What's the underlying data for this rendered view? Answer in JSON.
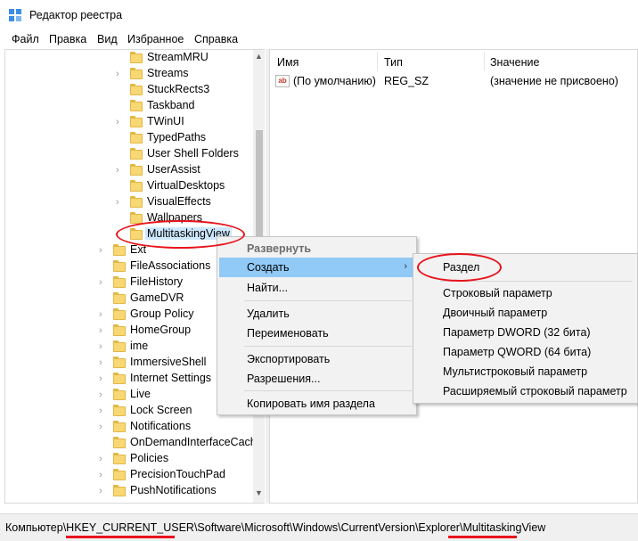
{
  "window": {
    "title": "Редактор реестра"
  },
  "menu": [
    "Файл",
    "Правка",
    "Вид",
    "Избранное",
    "Справка"
  ],
  "tree": {
    "items": [
      {
        "label": "StreamMRU",
        "level": 2,
        "expand": false
      },
      {
        "label": "Streams",
        "level": 2,
        "expand": true
      },
      {
        "label": "StuckRects3",
        "level": 2,
        "expand": false
      },
      {
        "label": "Taskband",
        "level": 2,
        "expand": false
      },
      {
        "label": "TWinUI",
        "level": 2,
        "expand": true
      },
      {
        "label": "TypedPaths",
        "level": 2,
        "expand": false
      },
      {
        "label": "User Shell Folders",
        "level": 2,
        "expand": false
      },
      {
        "label": "UserAssist",
        "level": 2,
        "expand": true
      },
      {
        "label": "VirtualDesktops",
        "level": 2,
        "expand": false
      },
      {
        "label": "VisualEffects",
        "level": 2,
        "expand": true
      },
      {
        "label": "Wallpapers",
        "level": 2,
        "expand": false
      },
      {
        "label": "MultitaskingView",
        "level": 2,
        "expand": false,
        "selected": true
      },
      {
        "label": "Ext",
        "level": 1,
        "expand": true
      },
      {
        "label": "FileAssociations",
        "level": 1,
        "expand": false
      },
      {
        "label": "FileHistory",
        "level": 1,
        "expand": true
      },
      {
        "label": "GameDVR",
        "level": 1,
        "expand": false
      },
      {
        "label": "Group Policy",
        "level": 1,
        "expand": true
      },
      {
        "label": "HomeGroup",
        "level": 1,
        "expand": true
      },
      {
        "label": "ime",
        "level": 1,
        "expand": true
      },
      {
        "label": "ImmersiveShell",
        "level": 1,
        "expand": true
      },
      {
        "label": "Internet Settings",
        "level": 1,
        "expand": true
      },
      {
        "label": "Live",
        "level": 1,
        "expand": true
      },
      {
        "label": "Lock Screen",
        "level": 1,
        "expand": true
      },
      {
        "label": "Notifications",
        "level": 1,
        "expand": true
      },
      {
        "label": "OnDemandInterfaceCach",
        "level": 1,
        "expand": false
      },
      {
        "label": "Policies",
        "level": 1,
        "expand": true
      },
      {
        "label": "PrecisionTouchPad",
        "level": 1,
        "expand": true
      },
      {
        "label": "PushNotifications",
        "level": 1,
        "expand": true
      }
    ]
  },
  "list": {
    "columns": [
      "Имя",
      "Тип",
      "Значение"
    ],
    "rows": [
      {
        "name": "(По умолчанию)",
        "type": "REG_SZ",
        "value": "(значение не присвоено)"
      }
    ]
  },
  "context_menu": {
    "items": [
      "Развернуть",
      "Создать",
      "Найти...",
      "Удалить",
      "Переименовать",
      "Экспортировать",
      "Разрешения...",
      "Копировать имя раздела"
    ],
    "submenu_arrow": "›"
  },
  "submenu": {
    "items": [
      "Раздел",
      "Строковый параметр",
      "Двоичный параметр",
      "Параметр DWORD (32 бита)",
      "Параметр QWORD (64 бита)",
      "Мультистроковый параметр",
      "Расширяемый строковый параметр"
    ]
  },
  "status": {
    "path": "Компьютер\\HKEY_CURRENT_USER\\Software\\Microsoft\\Windows\\CurrentVersion\\Explorer\\MultitaskingView"
  },
  "colors": {
    "highlight": "#91c9f7",
    "annotation_red": "#e8131b",
    "folder": "#f8d775"
  }
}
